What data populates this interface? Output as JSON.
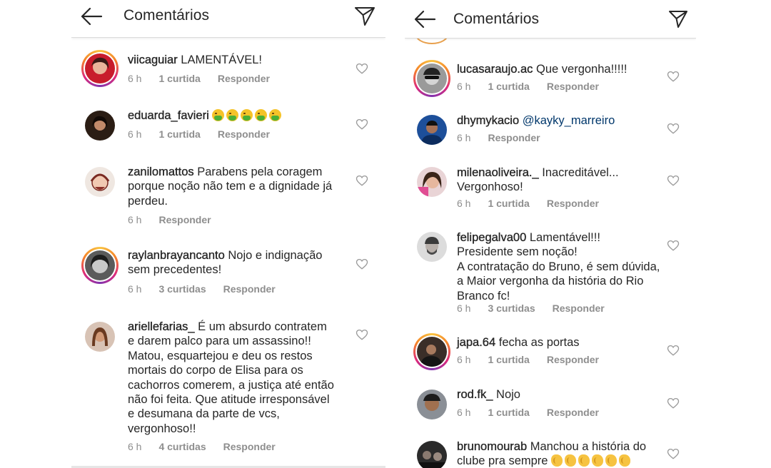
{
  "left": {
    "header": {
      "title": "Comentários"
    },
    "comments": [
      {
        "username": "viicaguiar",
        "text": "LAMENTÁVEL!",
        "time": "6 h",
        "likes": "1 curtida",
        "reply": "Responder"
      },
      {
        "username": "eduarda_favieri",
        "text": "",
        "emoji_icons": [
          "face-vomiting-icon",
          "face-vomiting-icon",
          "face-vomiting-icon",
          "face-vomiting-icon",
          "face-vomiting-icon"
        ],
        "time": "6 h",
        "likes": "1 curtida",
        "reply": "Responder"
      },
      {
        "username": "zanilomattos",
        "text": "Parabens pela coragem\nporque noção não tem e a dignidade já\nperdeu.",
        "time": "6 h",
        "reply": "Responder"
      },
      {
        "username": "raylanbrayancanto",
        "text": "Nojo e indignação\nsem precedentes!",
        "time": "6 h",
        "likes": "3 curtidas",
        "reply": "Responder"
      },
      {
        "username": "ariellefarias_",
        "text": "É um absurdo contratem\ne darem palco para um assassino!!\nMatou, esquartejou e deu os restos\nmortais do corpo de Elisa para os\ncachorros comerem, a justiça até então\nnão foi feita. Que atitude irresponsável\ne desumana da parte de vcs,\nvergonhoso!!",
        "time": "6 h",
        "likes": "4 curtidas",
        "reply": "Responder"
      }
    ]
  },
  "right": {
    "header": {
      "title": "Comentários"
    },
    "comments": [
      {
        "username": "lucasaraujo.ac",
        "text": "Que vergonha!!!!!",
        "time": "6 h",
        "likes": "1 curtida",
        "reply": "Responder"
      },
      {
        "username": "dhymykacio",
        "mention": "@kayky_marreiro",
        "text": "",
        "time": "6 h",
        "reply": "Responder"
      },
      {
        "username": "milenaoliveira._",
        "text": "Inacreditável...\nVergonhoso!",
        "time": "6 h",
        "likes": "1 curtida",
        "reply": "Responder"
      },
      {
        "username": "felipegalva00",
        "text": "Lamentável!!!\nPresidente sem noção!\nA contratação do Bruno, é sem dúvida,\na Maior vergonha da história do Rio\nBranco fc!",
        "time": "6 h",
        "likes": "3 curtidas",
        "reply": "Responder"
      },
      {
        "username": "japa.64",
        "text": "fecha as portas",
        "time": "6 h",
        "likes": "1 curtida",
        "reply": "Responder"
      },
      {
        "username": "rod.fk_",
        "text": "Nojo",
        "time": "6 h",
        "likes": "1 curtida",
        "reply": "Responder"
      },
      {
        "username": "brunomourab",
        "text": "Manchou a história do\nclube pra sempre ",
        "emoji_icons": [
          "clapping-hands-icon",
          "clapping-hands-icon",
          "clapping-hands-icon",
          "clapping-hands-icon",
          "clapping-hands-icon",
          "clapping-hands-icon"
        ]
      }
    ]
  },
  "colors": {
    "text": "#262626",
    "meta": "#8e8e8e",
    "mention": "#00376b",
    "divider": "#dbdbdb"
  },
  "icons": {
    "back": "arrow-left-icon",
    "send": "paper-plane-icon",
    "like": "heart-outline-icon"
  }
}
